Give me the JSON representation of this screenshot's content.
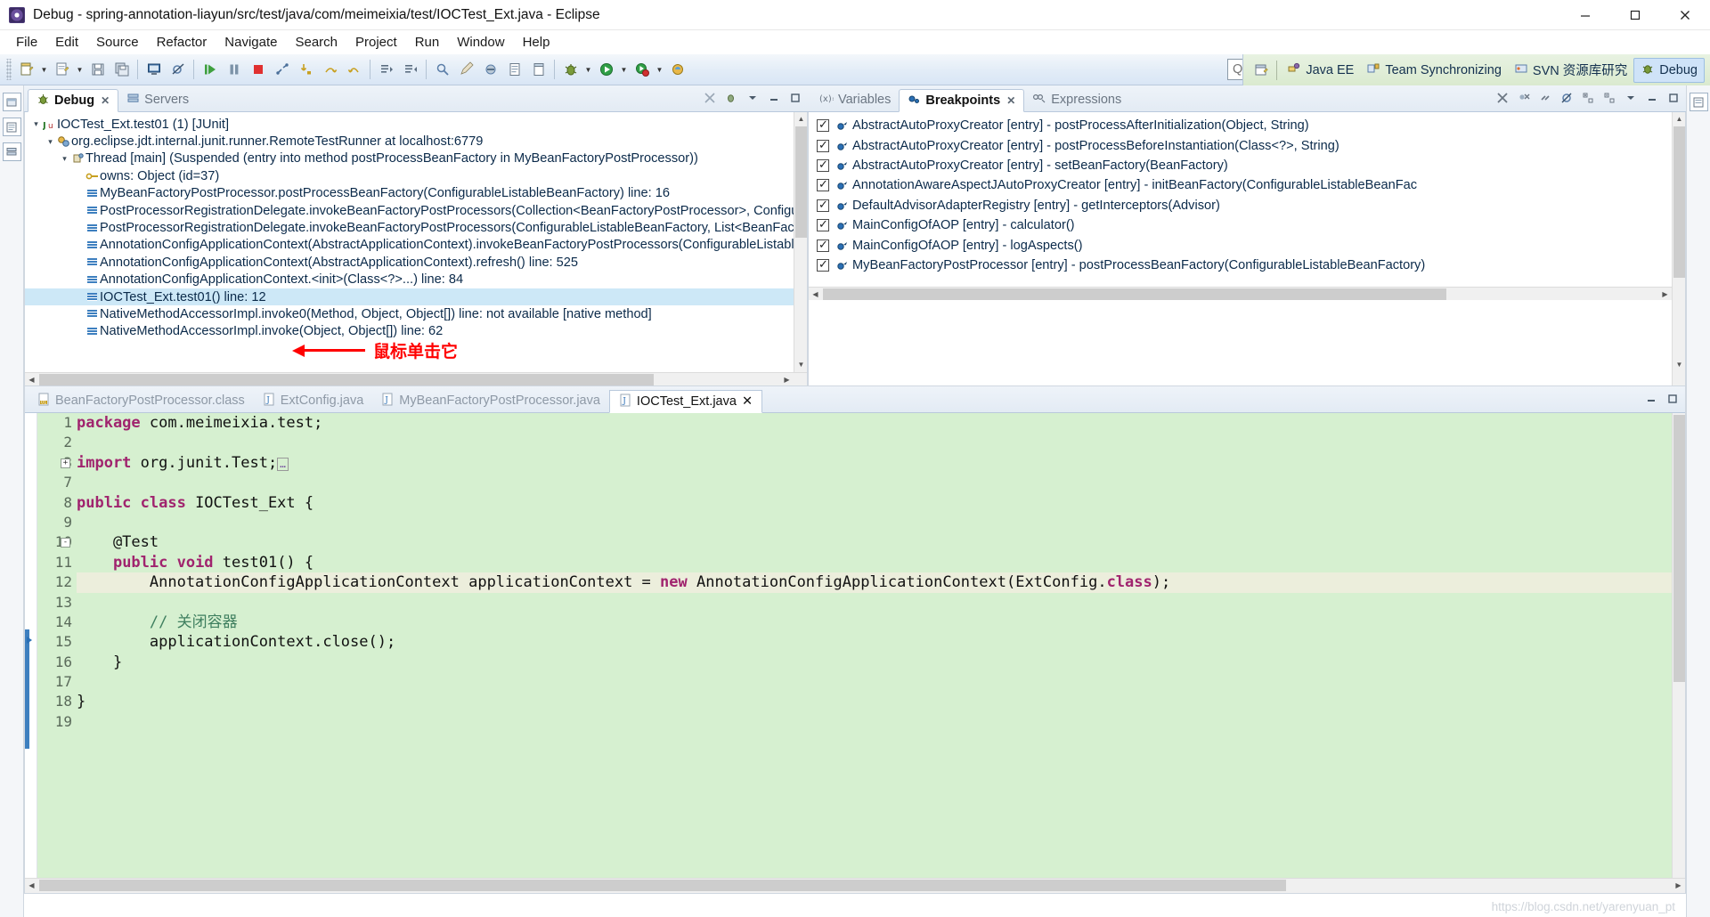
{
  "window": {
    "title": "Debug - spring-annotation-liayun/src/test/java/com/meimeixia/test/IOCTest_Ext.java - Eclipse",
    "minimize": "—",
    "maximize": "▢",
    "close": "✕"
  },
  "menubar": [
    "File",
    "Edit",
    "Source",
    "Refactor",
    "Navigate",
    "Search",
    "Project",
    "Run",
    "Window",
    "Help"
  ],
  "toolbar": {
    "quick_access_placeholder": "Quick Access",
    "groups": [
      [
        "new-wizard-icon",
        "new-wizard-dropdown",
        "new-java-class-icon",
        "new-java-class-dropdown",
        "save-icon",
        "save-all-icon",
        "console-icon",
        "skip-breakpoints-icon"
      ],
      [
        "resume-icon",
        "suspend-icon",
        "terminate-icon",
        "disconnect-icon",
        "step-into-icon",
        "step-over-icon",
        "step-return-icon"
      ],
      [
        "next-annotation-icon",
        "previous-annotation-icon"
      ],
      [
        "search-icon",
        "pencil-icon",
        "toggle-mark-icon",
        "open-type-icon",
        "open-task-icon"
      ],
      [
        "debug-icon",
        "debug-dropdown",
        "run-icon",
        "run-dropdown",
        "coverage-icon",
        "coverage-dropdown",
        "external-tools-icon"
      ]
    ]
  },
  "perspectives": {
    "open_perspective_icon": "open-perspective-icon",
    "items": [
      {
        "label": "Java EE",
        "icon": "java-ee-icon",
        "active": false
      },
      {
        "label": "Team Synchronizing",
        "icon": "team-sync-icon",
        "active": false
      },
      {
        "label": "SVN 资源库研究",
        "icon": "svn-icon",
        "active": false
      },
      {
        "label": "Debug",
        "icon": "debug-perspective-icon",
        "active": true
      }
    ]
  },
  "debug_view": {
    "tabs": [
      {
        "label": "Debug",
        "icon": "debug-icon",
        "active": true,
        "closeable": true
      },
      {
        "label": "Servers",
        "icon": "servers-icon",
        "active": false,
        "closeable": false
      }
    ],
    "toolbar_icons": [
      "remove-all-terminated-icon",
      "show-debug-toolbar-icon",
      "view-menu-icon",
      "minimize-icon",
      "maximize-icon"
    ],
    "tree": [
      {
        "indent": 0,
        "twisty": "▾",
        "icon": "junit-icon",
        "label": "IOCTest_Ext.test01 (1) [JUnit]",
        "selected": false
      },
      {
        "indent": 1,
        "twisty": "▾",
        "icon": "java-process-icon",
        "label": "org.eclipse.jdt.internal.junit.runner.RemoteTestRunner at localhost:6779",
        "selected": false
      },
      {
        "indent": 2,
        "twisty": "▾",
        "icon": "thread-icon",
        "label": "Thread [main] (Suspended (entry into method postProcessBeanFactory in MyBeanFactoryPostProcessor))",
        "selected": false
      },
      {
        "indent": 3,
        "twisty": "",
        "icon": "monitor-icon",
        "label": "owns: Object  (id=37)",
        "selected": false
      },
      {
        "indent": 3,
        "twisty": "",
        "icon": "stackframe-icon",
        "label": "MyBeanFactoryPostProcessor.postProcessBeanFactory(ConfigurableListableBeanFactory) line: 16",
        "selected": false
      },
      {
        "indent": 3,
        "twisty": "",
        "icon": "stackframe-icon",
        "label": "PostProcessorRegistrationDelegate.invokeBeanFactoryPostProcessors(Collection<BeanFactoryPostProcessor>, ConfigurableL",
        "selected": false
      },
      {
        "indent": 3,
        "twisty": "",
        "icon": "stackframe-icon",
        "label": "PostProcessorRegistrationDelegate.invokeBeanFactoryPostProcessors(ConfigurableListableBeanFactory, List<BeanFactoryPos",
        "selected": false
      },
      {
        "indent": 3,
        "twisty": "",
        "icon": "stackframe-icon",
        "label": "AnnotationConfigApplicationContext(AbstractApplicationContext).invokeBeanFactoryPostProcessors(ConfigurableListableBea",
        "selected": false
      },
      {
        "indent": 3,
        "twisty": "",
        "icon": "stackframe-icon",
        "label": "AnnotationConfigApplicationContext(AbstractApplicationContext).refresh() line: 525",
        "selected": false
      },
      {
        "indent": 3,
        "twisty": "",
        "icon": "stackframe-icon",
        "label": "AnnotationConfigApplicationContext.<init>(Class<?>...) line: 84",
        "selected": false
      },
      {
        "indent": 3,
        "twisty": "",
        "icon": "stackframe-icon",
        "label": "IOCTest_Ext.test01() line: 12",
        "selected": true
      },
      {
        "indent": 3,
        "twisty": "",
        "icon": "stackframe-icon",
        "label": "NativeMethodAccessorImpl.invoke0(Method, Object, Object[]) line: not available [native method]",
        "selected": false
      },
      {
        "indent": 3,
        "twisty": "",
        "icon": "stackframe-icon",
        "label": "NativeMethodAccessorImpl.invoke(Object, Object[]) line: 62",
        "selected": false
      }
    ],
    "annotation": {
      "text": "鼠标单击它",
      "color": "#ff0000"
    }
  },
  "breakpoints_view": {
    "tabs": [
      {
        "label": "Variables",
        "icon": "variables-icon",
        "active": false,
        "closeable": false
      },
      {
        "label": "Breakpoints",
        "icon": "breakpoints-icon",
        "active": true,
        "closeable": true
      },
      {
        "label": "Expressions",
        "icon": "expressions-icon",
        "active": false,
        "closeable": false
      }
    ],
    "toolbar_icons": [
      "remove-breakpoint-icon",
      "remove-all-breakpoints-icon",
      "link-with-debug-view-icon",
      "skip-breakpoints-icon",
      "expand-all-icon",
      "collapse-all-icon",
      "view-menu-icon",
      "minimize-icon",
      "maximize-icon"
    ],
    "items": [
      {
        "checked": true,
        "label": "AbstractAutoProxyCreator [entry] - postProcessAfterInitialization(Object, String)"
      },
      {
        "checked": true,
        "label": "AbstractAutoProxyCreator [entry] - postProcessBeforeInstantiation(Class<?>, String)"
      },
      {
        "checked": true,
        "label": "AbstractAutoProxyCreator [entry] - setBeanFactory(BeanFactory)"
      },
      {
        "checked": true,
        "label": "AnnotationAwareAspectJAutoProxyCreator [entry] - initBeanFactory(ConfigurableListableBeanFac"
      },
      {
        "checked": true,
        "label": "DefaultAdvisorAdapterRegistry [entry] - getInterceptors(Advisor)"
      },
      {
        "checked": true,
        "label": "MainConfigOfAOP [entry] - calculator()"
      },
      {
        "checked": true,
        "label": "MainConfigOfAOP [entry] - logAspects()"
      },
      {
        "checked": true,
        "label": "MyBeanFactoryPostProcessor [entry] - postProcessBeanFactory(ConfigurableListableBeanFactory)"
      }
    ]
  },
  "editor": {
    "tabs": [
      {
        "label": "BeanFactoryPostProcessor.class",
        "icon": "class-file-icon",
        "active": false,
        "closeable": false
      },
      {
        "label": "ExtConfig.java",
        "icon": "java-file-icon",
        "active": false,
        "closeable": false
      },
      {
        "label": "MyBeanFactoryPostProcessor.java",
        "icon": "java-file-icon",
        "active": false,
        "closeable": false
      },
      {
        "label": "IOCTest_Ext.java",
        "icon": "java-file-icon",
        "active": true,
        "closeable": true
      }
    ],
    "toolbar_icons": [
      "minimize-icon",
      "maximize-icon"
    ],
    "current_line": 12,
    "lines": [
      {
        "num": "1",
        "fold": "",
        "breakpoint": false,
        "current": false,
        "tokens": [
          {
            "t": "package",
            "c": "kw"
          },
          {
            "t": " com.meimeixia.test;",
            "c": "plain"
          }
        ]
      },
      {
        "num": "2",
        "fold": "",
        "breakpoint": false,
        "current": false,
        "tokens": [
          {
            "t": "",
            "c": "plain"
          }
        ]
      },
      {
        "num": "3",
        "fold": "+",
        "breakpoint": false,
        "current": false,
        "tokens": [
          {
            "t": "import",
            "c": "kw"
          },
          {
            "t": " org.junit.Test;",
            "c": "plain"
          },
          {
            "t": "▫",
            "c": "fold-box"
          }
        ]
      },
      {
        "num": "7",
        "fold": "",
        "breakpoint": false,
        "current": false,
        "tokens": [
          {
            "t": "",
            "c": "plain"
          }
        ]
      },
      {
        "num": "8",
        "fold": "",
        "breakpoint": false,
        "current": false,
        "tokens": [
          {
            "t": "public class",
            "c": "kw"
          },
          {
            "t": " IOCTest_Ext {",
            "c": "plain"
          }
        ]
      },
      {
        "num": "9",
        "fold": "",
        "breakpoint": false,
        "current": false,
        "tokens": [
          {
            "t": "",
            "c": "plain"
          }
        ]
      },
      {
        "num": "10",
        "fold": "-",
        "breakpoint": false,
        "current": false,
        "tokens": [
          {
            "t": "    @Test",
            "c": "plain"
          }
        ]
      },
      {
        "num": "11",
        "fold": "",
        "breakpoint": false,
        "current": false,
        "tokens": [
          {
            "t": "    ",
            "c": "plain"
          },
          {
            "t": "public void",
            "c": "kw"
          },
          {
            "t": " test01() {",
            "c": "plain"
          }
        ]
      },
      {
        "num": "12",
        "fold": "",
        "breakpoint": false,
        "current": true,
        "tokens": [
          {
            "t": "        AnnotationConfigApplicationContext applicationContext = ",
            "c": "plain"
          },
          {
            "t": "new",
            "c": "kw"
          },
          {
            "t": " AnnotationConfigApplicationContext(ExtConfig.",
            "c": "plain"
          },
          {
            "t": "class",
            "c": "kw"
          },
          {
            "t": ");",
            "c": "plain"
          }
        ]
      },
      {
        "num": "13",
        "fold": "",
        "breakpoint": false,
        "current": false,
        "tokens": [
          {
            "t": "",
            "c": "plain"
          }
        ]
      },
      {
        "num": "14",
        "fold": "",
        "breakpoint": false,
        "current": false,
        "tokens": [
          {
            "t": "        ",
            "c": "plain"
          },
          {
            "t": "// 关闭容器",
            "c": "cmt"
          }
        ]
      },
      {
        "num": "15",
        "fold": "",
        "breakpoint": false,
        "current": false,
        "tokens": [
          {
            "t": "        applicationContext.close();",
            "c": "plain"
          }
        ]
      },
      {
        "num": "16",
        "fold": "",
        "breakpoint": false,
        "current": false,
        "tokens": [
          {
            "t": "    }",
            "c": "plain"
          }
        ]
      },
      {
        "num": "17",
        "fold": "",
        "breakpoint": false,
        "current": false,
        "tokens": [
          {
            "t": "",
            "c": "plain"
          }
        ]
      },
      {
        "num": "18",
        "fold": "",
        "breakpoint": false,
        "current": false,
        "tokens": [
          {
            "t": "}",
            "c": "plain"
          }
        ]
      },
      {
        "num": "19",
        "fold": "",
        "breakpoint": false,
        "current": false,
        "tokens": [
          {
            "t": "",
            "c": "plain"
          }
        ]
      }
    ]
  },
  "watermark": "https://blog.csdn.net/yarenyuan_pt"
}
